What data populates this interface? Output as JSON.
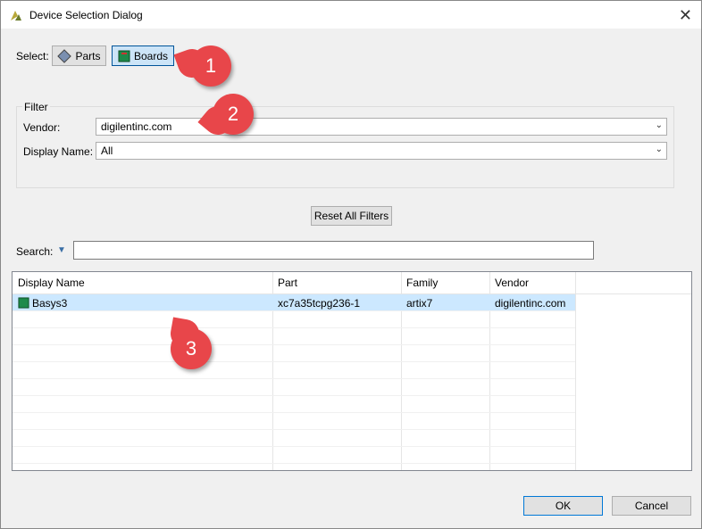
{
  "window": {
    "title": "Device Selection Dialog",
    "close_icon": "close-icon"
  },
  "select": {
    "label": "Select:",
    "parts": "Parts",
    "boards": "Boards",
    "active": "Boards"
  },
  "filter": {
    "legend": "Filter",
    "vendor_label": "Vendor:",
    "vendor_value": "digilentinc.com",
    "display_name_label": "Display Name:",
    "display_name_value": "All"
  },
  "reset_button": "Reset All Filters",
  "search": {
    "label": "Search:",
    "value": ""
  },
  "table": {
    "columns": [
      "Display Name",
      "Part",
      "Family",
      "Vendor"
    ],
    "rows": [
      {
        "display_name": "Basys3",
        "part": "xc7a35tcpg236-1",
        "family": "artix7",
        "vendor": "digilentinc.com"
      }
    ]
  },
  "markers": [
    "1",
    "2",
    "3"
  ],
  "footer": {
    "ok": "OK",
    "cancel": "Cancel"
  },
  "colors": {
    "marker": "#e8464a",
    "selection": "#cce8ff"
  }
}
